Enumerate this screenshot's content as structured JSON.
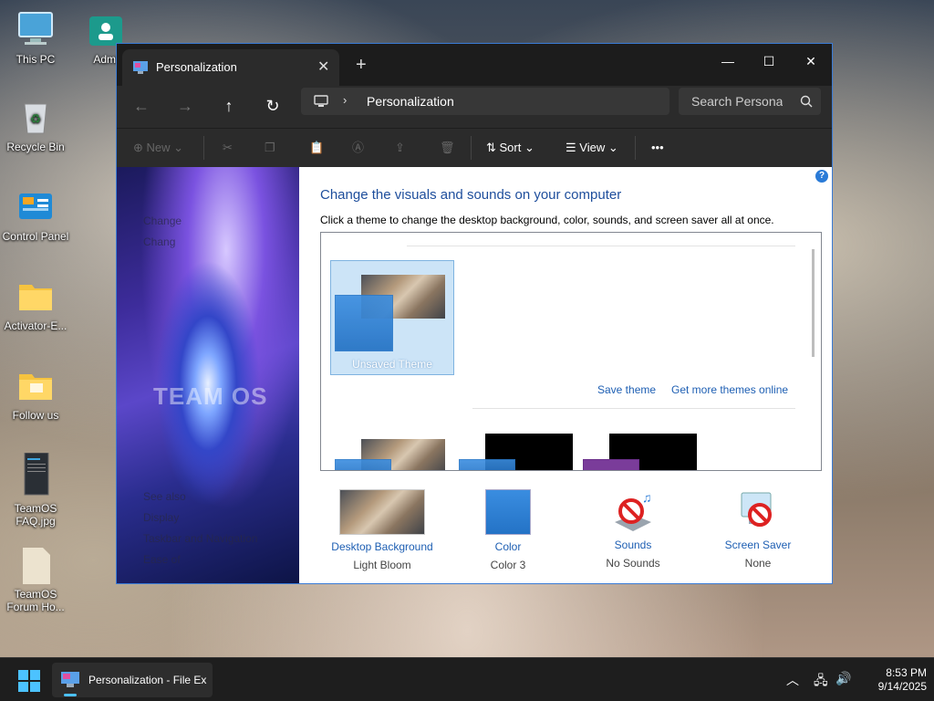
{
  "desktop": {
    "icons": [
      {
        "label": "This PC"
      },
      {
        "label": "Admi"
      },
      {
        "label": "Recycle Bin"
      },
      {
        "label": "Control Panel"
      },
      {
        "label": "Activator-E..."
      },
      {
        "label": "Follow us"
      },
      {
        "label": "TeamOS FAQ.jpg"
      },
      {
        "label": "TeamOS Forum Ho..."
      }
    ]
  },
  "window": {
    "tab_title": "Personalization",
    "tab_close": "✕",
    "new_tab": "+",
    "controls": {
      "minimize": "—",
      "maximize": "☐",
      "close": "✕"
    },
    "address": {
      "crumb": "Personalization",
      "separator": "›"
    },
    "search": {
      "placeholder": "Search Personal"
    },
    "toolbar": {
      "new": "New",
      "sort": "Sort",
      "view": "View",
      "more": "•••"
    }
  },
  "left_pane": {
    "links": [
      "Change",
      "Chang"
    ],
    "see_also": "See also",
    "see_also_links": [
      "Display",
      "Taskbar and Navigation",
      "Ease of"
    ],
    "watermark": "TEAM OS"
  },
  "main": {
    "title": "Change the visuals and sounds on your computer",
    "subtitle": "Click a theme to change the desktop background, color, sounds, and screen saver all at once.",
    "help": "?",
    "selected_theme": "Unsaved Theme",
    "save_theme": "Save theme",
    "get_more": "Get more themes online",
    "bottom": [
      {
        "label": "Desktop Background",
        "value": "Light Bloom"
      },
      {
        "label": "Color",
        "value": "Color 3"
      },
      {
        "label": "Sounds",
        "value": "No Sounds"
      },
      {
        "label": "Screen Saver",
        "value": "None"
      }
    ]
  },
  "taskbar": {
    "app_label": "Personalization - File Ex",
    "time": "8:53 PM",
    "date": "9/14/2025"
  },
  "colors": {
    "accent": "#3a7bd5",
    "link": "#1e5fb3",
    "title": "#1e4e9c",
    "selection": "#cce4f7"
  }
}
